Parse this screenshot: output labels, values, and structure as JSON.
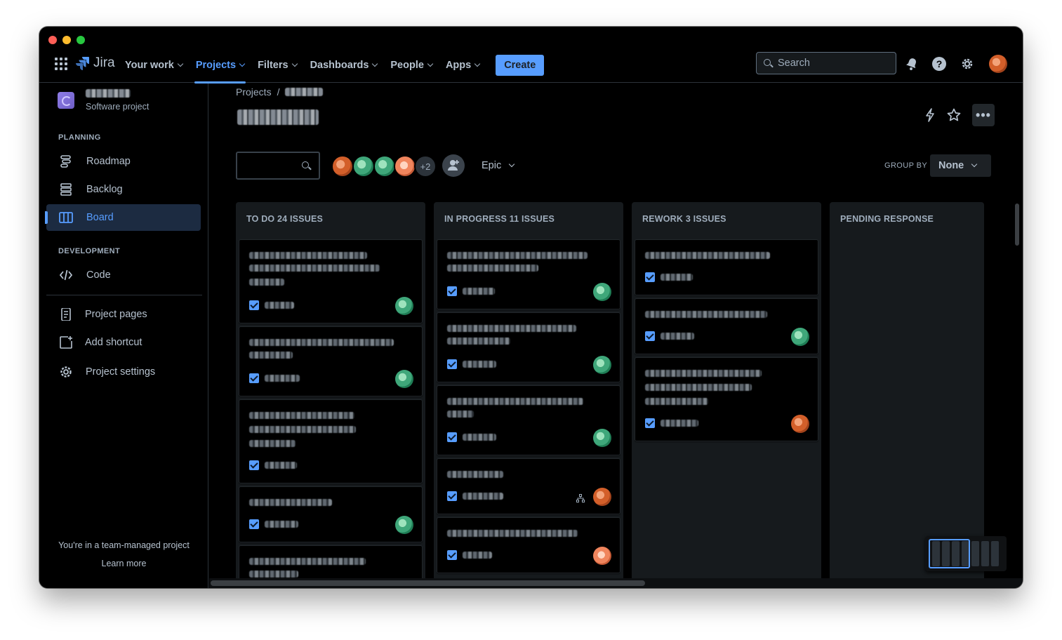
{
  "app": {
    "name": "Jira"
  },
  "nav": {
    "items": [
      {
        "label": "Your work"
      },
      {
        "label": "Projects",
        "active": true
      },
      {
        "label": "Filters"
      },
      {
        "label": "Dashboards"
      },
      {
        "label": "People"
      },
      {
        "label": "Apps"
      }
    ],
    "create_label": "Create",
    "search_placeholder": "Search"
  },
  "sidebar": {
    "project_type": "Software project",
    "sections": [
      {
        "label": "PLANNING",
        "items": [
          {
            "label": "Roadmap"
          },
          {
            "label": "Backlog"
          },
          {
            "label": "Board",
            "active": true
          }
        ]
      },
      {
        "label": "DEVELOPMENT",
        "items": [
          {
            "label": "Code"
          }
        ]
      }
    ],
    "extras": [
      {
        "label": "Project pages"
      },
      {
        "label": "Add shortcut"
      },
      {
        "label": "Project settings"
      }
    ],
    "footer_text": "You're in a team-managed project",
    "footer_link": "Learn more"
  },
  "breadcrumb": {
    "root": "Projects",
    "separator": "/"
  },
  "toolbar": {
    "more_avatars": "+2",
    "epic_filter": "Epic",
    "group_by_label": "GROUP BY",
    "group_by_value": "None"
  },
  "board": {
    "columns": [
      {
        "title": "TO DO 24 ISSUES"
      },
      {
        "title": "IN PROGRESS 11 ISSUES"
      },
      {
        "title": "REWORK 3 ISSUES"
      },
      {
        "title": "PENDING RESPONSE"
      }
    ]
  },
  "colors": {
    "accent": "#579dff",
    "background": "#000000",
    "column": "#161a1d",
    "text": "#b6c2cf",
    "subtle_text": "#9fadbc"
  }
}
